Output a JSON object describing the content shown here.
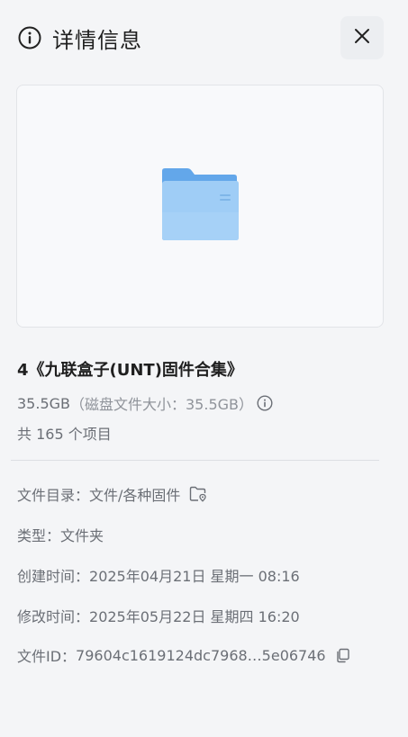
{
  "header": {
    "title": "详情信息"
  },
  "file": {
    "name": "4《九联盒子(UNT)固件合集》",
    "size": "35.5GB",
    "disk_size_text": "（磁盘文件大小：35.5GB）",
    "item_count_text": "共 165 个项目"
  },
  "meta": {
    "directory_label": "文件目录：",
    "directory_value": "文件/各种固件",
    "type_label": "类型：",
    "type_value": "文件夹",
    "created_label": "创建时间：",
    "created_value": "2025年04月21日 星期一 08:16",
    "modified_label": "修改时间：",
    "modified_value": "2025年05月22日 星期四 16:20",
    "id_label": "文件ID：",
    "id_value": "79604c1619124dc7968…5e06746"
  },
  "colors": {
    "folder_back": "#63a7ea",
    "folder_front": "#9fcdf6",
    "background": "#f4f5f7"
  },
  "icons": {
    "header": "info-circle-icon",
    "close": "close-icon",
    "preview": "folder-icon",
    "size_info": "info-circle-icon",
    "directory": "folder-location-icon",
    "copy": "copy-icon"
  }
}
